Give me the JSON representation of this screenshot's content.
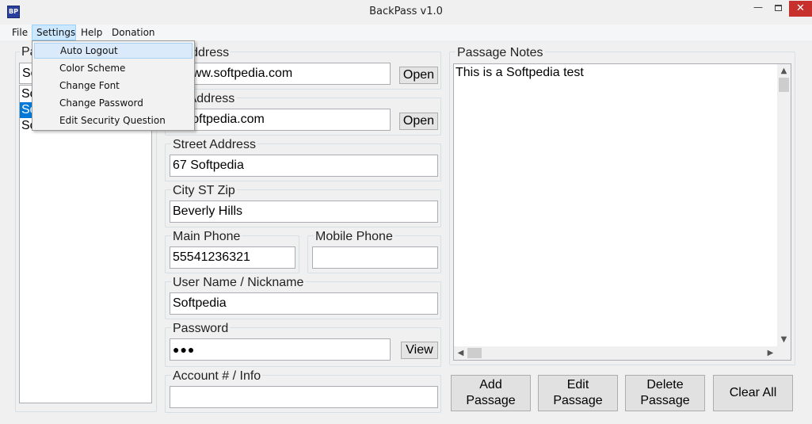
{
  "window": {
    "title": "BackPass v1.0",
    "app_icon_text": "BP",
    "min_glyph": "—",
    "close_glyph": "✕"
  },
  "menubar": {
    "file": "File",
    "settings": "Settings",
    "help": "Help",
    "donation": "Donation"
  },
  "settings_menu": {
    "items": [
      "Auto Logout",
      "Color Scheme",
      "Change Font",
      "Change Password",
      "Edit Security Question"
    ]
  },
  "left_panel": {
    "label_visible": "Pa",
    "search_value": "So",
    "list_items": [
      "So",
      "So",
      "So"
    ],
    "selected_index": 1
  },
  "web_address": {
    "label": "b Address",
    "value": "://www.softpedia.com",
    "button": "Open"
  },
  "email_address": {
    "label": "ail Address",
    "value": "@softpedia.com",
    "button": "Open"
  },
  "street_address": {
    "label": "Street Address",
    "value": "67 Softpedia"
  },
  "city": {
    "label": "City ST Zip",
    "value": "Beverly Hills"
  },
  "main_phone": {
    "label": "Main Phone",
    "value": "55541236321"
  },
  "mobile_phone": {
    "label": "Mobile Phone",
    "value": ""
  },
  "username": {
    "label": "User Name / Nickname",
    "value": "Softpedia"
  },
  "password": {
    "label": "Password",
    "value": "●●●",
    "button": "View"
  },
  "account": {
    "label": "Account # / Info",
    "value": ""
  },
  "notes": {
    "label": "Passage Notes",
    "value": "This is a Softpedia test"
  },
  "buttons": {
    "add": "Add\nPassage",
    "edit": "Edit\nPassage",
    "delete": "Delete\nPassage",
    "clear": "Clear All"
  },
  "scroll_glyphs": {
    "up": "▲",
    "down": "▼",
    "left": "◀",
    "right": "▶"
  },
  "colors": {
    "selection": "#0078d7",
    "menu_highlight": "#cce8ff",
    "close_button": "#c7312d"
  }
}
